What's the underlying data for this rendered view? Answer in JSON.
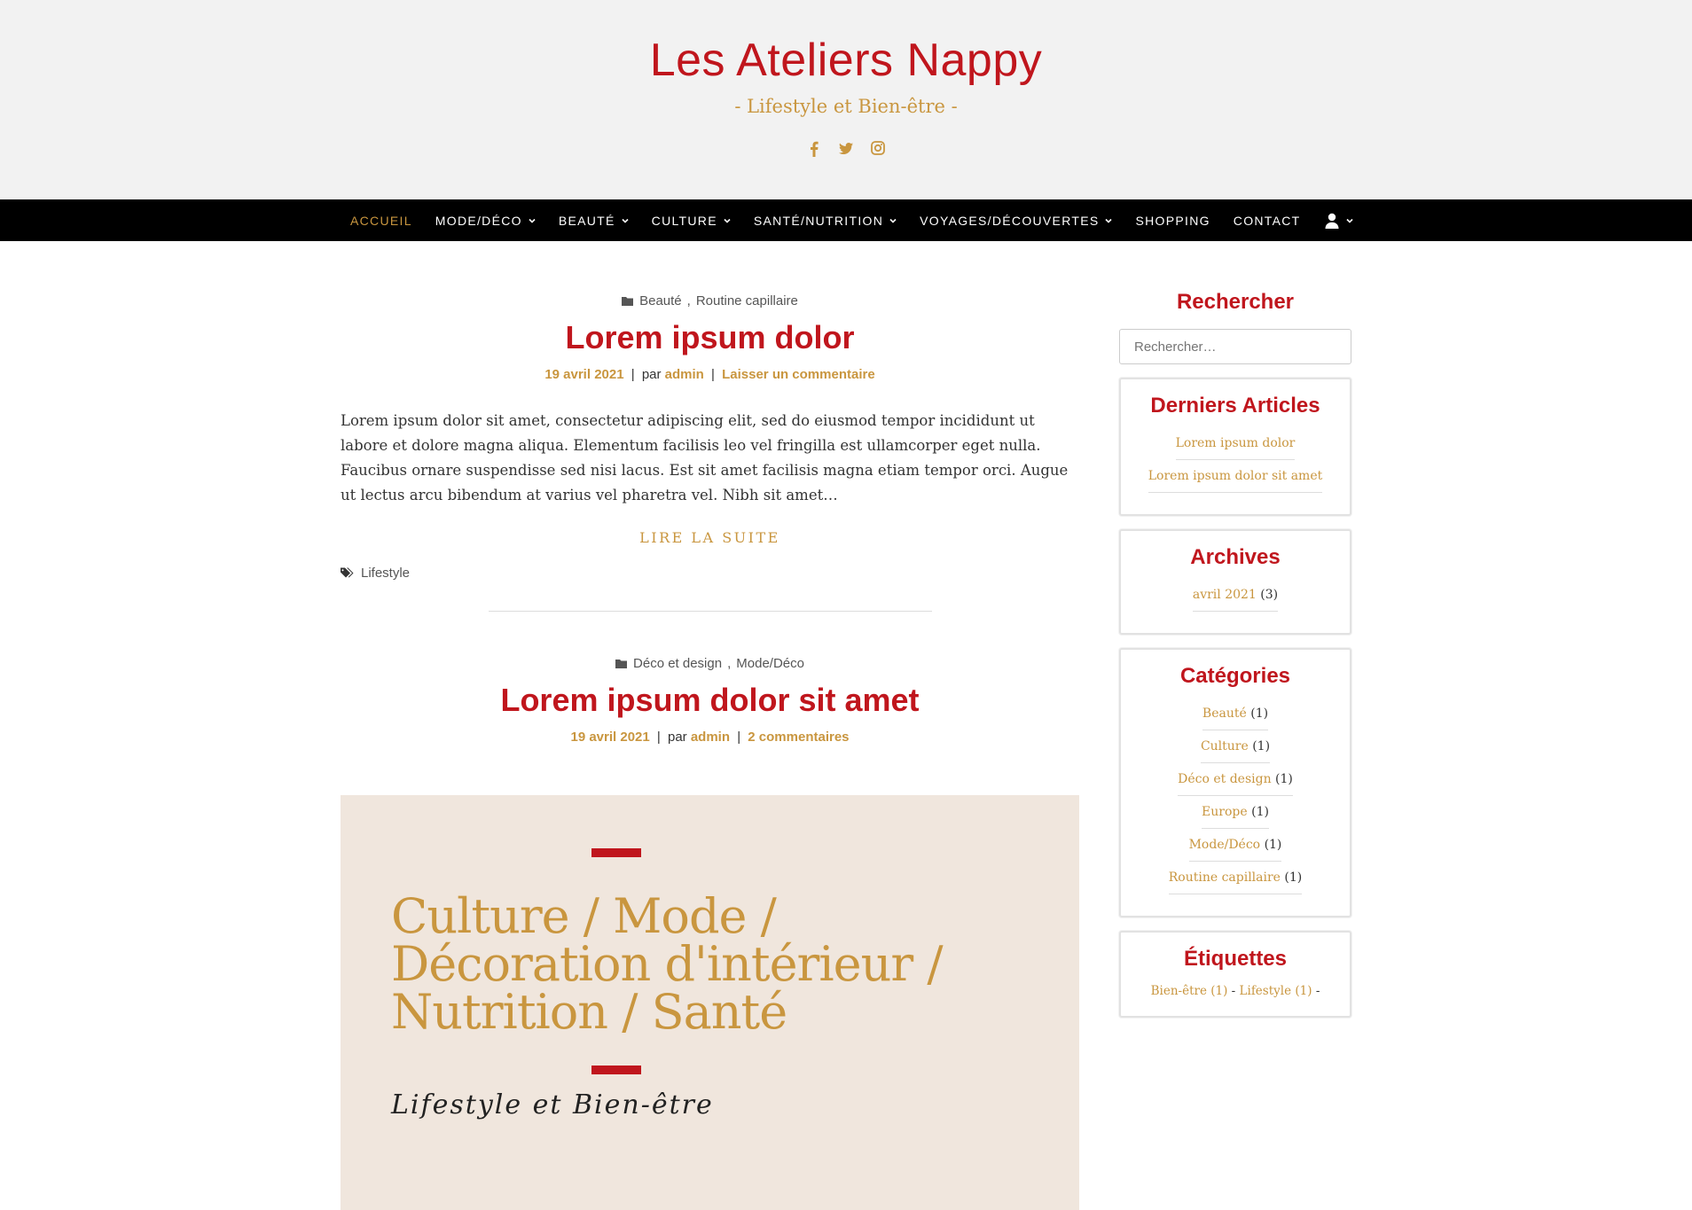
{
  "header": {
    "site_title": "Les Ateliers Nappy",
    "tagline": "- Lifestyle et Bien-être -",
    "social_icons": [
      "facebook-icon",
      "twitter-icon",
      "instagram-icon"
    ]
  },
  "nav": {
    "items": [
      {
        "label": "ACCUEIL",
        "active": true,
        "dropdown": false
      },
      {
        "label": "MODE/DÉCO",
        "active": false,
        "dropdown": true
      },
      {
        "label": "BEAUTÉ",
        "active": false,
        "dropdown": true
      },
      {
        "label": "CULTURE",
        "active": false,
        "dropdown": true
      },
      {
        "label": "SANTÉ/NUTRITION",
        "active": false,
        "dropdown": true
      },
      {
        "label": "VOYAGES/DÉCOUVERTES",
        "active": false,
        "dropdown": true
      },
      {
        "label": "SHOPPING",
        "active": false,
        "dropdown": false
      },
      {
        "label": "CONTACT",
        "active": false,
        "dropdown": false
      }
    ],
    "user_icon": "user-icon"
  },
  "posts": [
    {
      "categories": [
        "Beauté",
        "Routine capillaire"
      ],
      "title": "Lorem ipsum dolor",
      "date": "19 avril 2021",
      "by": "par",
      "author": "admin",
      "comments": "Laisser un commentaire",
      "excerpt": "Lorem ipsum dolor sit amet, consectetur adipiscing elit, sed do eiusmod tempor incididunt ut labore et dolore magna aliqua. Elementum facilisis leo vel fringilla est ullamcorper eget nulla. Faucibus ornare suspendisse sed nisi lacus. Est sit amet facilisis magna etiam tempor orci. Augue ut lectus arcu bibendum at varius vel pharetra vel. Nibh sit amet…",
      "read_more": "LIRE LA SUITE",
      "tags": [
        "Lifestyle"
      ]
    },
    {
      "categories": [
        "Déco et design",
        "Mode/Déco"
      ],
      "title": "Lorem ipsum dolor sit amet",
      "date": "19 avril 2021",
      "by": "par",
      "author": "admin",
      "comments": "2 commentaires",
      "featured": {
        "line1": "Culture / Mode /",
        "line2": "Décoration d'intérieur /",
        "line3": "Nutrition / Santé",
        "script": "Lifestyle et Bien-être"
      }
    }
  ],
  "sidebar": {
    "search": {
      "title": "Rechercher",
      "placeholder": "Rechercher…"
    },
    "recent": {
      "title": "Derniers Articles",
      "items": [
        "Lorem ipsum dolor",
        "Lorem ipsum dolor sit amet"
      ]
    },
    "archives": {
      "title": "Archives",
      "items": [
        {
          "label": "avril 2021",
          "count": "(3)"
        }
      ]
    },
    "categories": {
      "title": "Catégories",
      "items": [
        {
          "label": "Beauté",
          "count": "(1)"
        },
        {
          "label": "Culture",
          "count": "(1)"
        },
        {
          "label": "Déco et design",
          "count": "(1)"
        },
        {
          "label": "Europe",
          "count": "(1)"
        },
        {
          "label": "Mode/Déco",
          "count": "(1)"
        },
        {
          "label": "Routine capillaire",
          "count": "(1)"
        }
      ]
    },
    "tags": {
      "title": "Étiquettes",
      "items": [
        {
          "label": "Bien-être (1)"
        },
        {
          "label": "Lifestyle (1)"
        }
      ],
      "separator": "-"
    }
  },
  "colors": {
    "accent_red": "#c0161d",
    "accent_gold": "#c9963f",
    "nav_bg": "#000000",
    "header_bg": "#f2f2f2"
  }
}
